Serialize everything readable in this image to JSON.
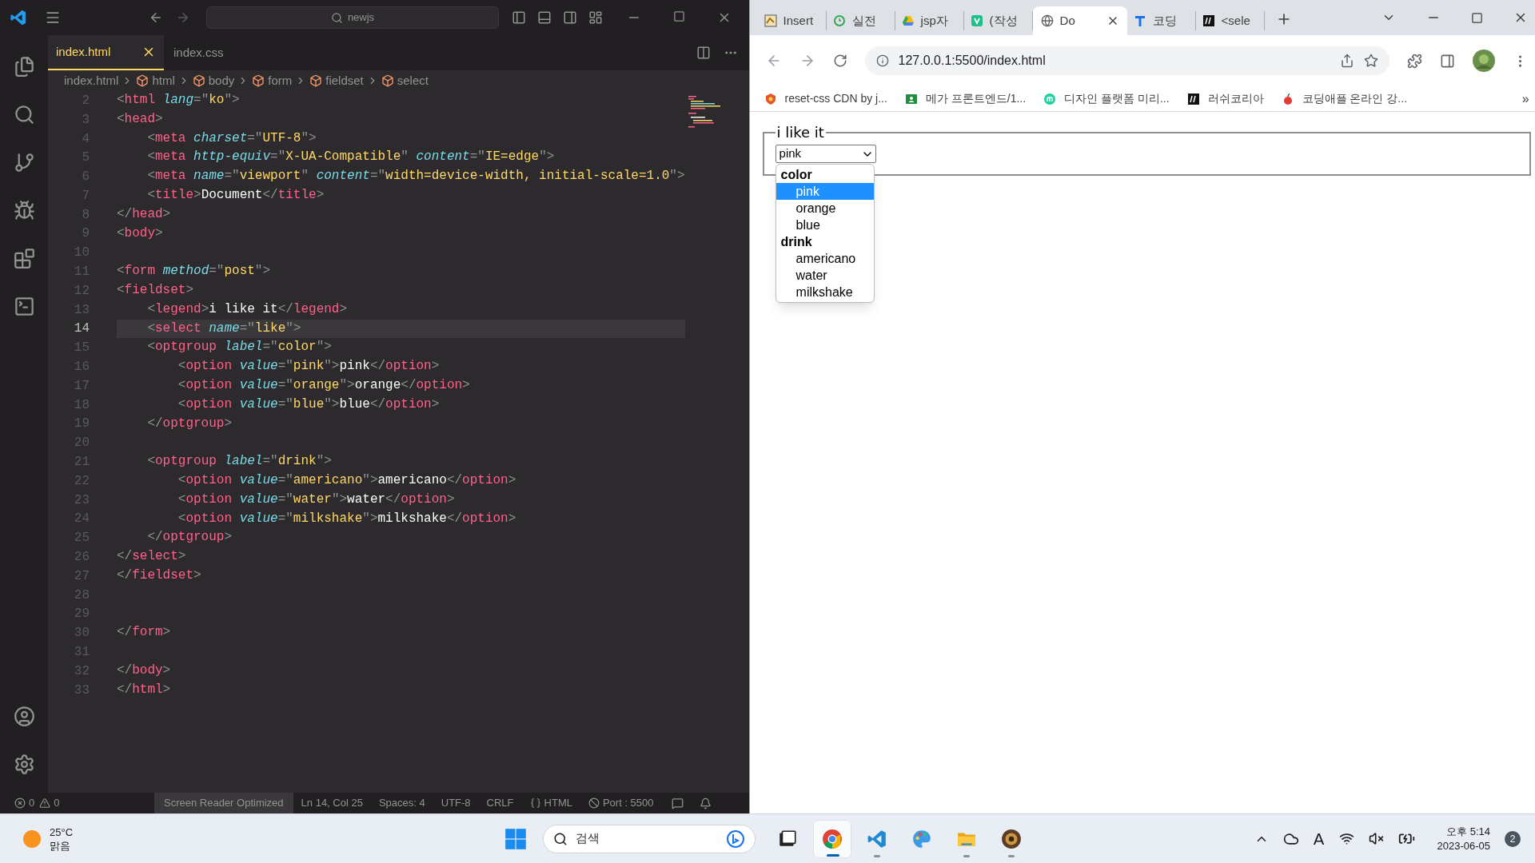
{
  "vscode": {
    "title_bar": {
      "search": "newjs"
    },
    "tabs": [
      {
        "label": "index.html",
        "selected": true
      },
      {
        "label": "index.css",
        "selected": false
      }
    ],
    "breadcrumb": [
      {
        "kind": "file",
        "label": "index.html"
      },
      {
        "kind": "element",
        "label": "html"
      },
      {
        "kind": "element",
        "label": "body"
      },
      {
        "kind": "element",
        "label": "form"
      },
      {
        "kind": "element",
        "label": "fieldset"
      },
      {
        "kind": "element",
        "label": "select"
      }
    ],
    "lines": [
      {
        "number": "2",
        "current": false,
        "tokens": [
          {
            "kind": "punct",
            "text": "<"
          },
          {
            "kind": "tag",
            "text": "html "
          },
          {
            "kind": "attr",
            "text": "lang"
          },
          {
            "kind": "punct",
            "text": "=\""
          },
          {
            "kind": "string",
            "text": "ko"
          },
          {
            "kind": "punct",
            "text": "\">"
          }
        ]
      },
      {
        "number": "3",
        "current": false,
        "tokens": [
          {
            "kind": "punct",
            "text": "<"
          },
          {
            "kind": "tag",
            "text": "head"
          },
          {
            "kind": "punct",
            "text": ">"
          }
        ]
      },
      {
        "number": "4",
        "current": false,
        "tokens": [
          {
            "kind": "punct",
            "text": "    <"
          },
          {
            "kind": "tag",
            "text": "meta "
          },
          {
            "kind": "attr",
            "text": "charset"
          },
          {
            "kind": "punct",
            "text": "=\""
          },
          {
            "kind": "string",
            "text": "UTF-8"
          },
          {
            "kind": "punct",
            "text": "\">"
          }
        ]
      },
      {
        "number": "5",
        "current": false,
        "tokens": [
          {
            "kind": "punct",
            "text": "    <"
          },
          {
            "kind": "tag",
            "text": "meta "
          },
          {
            "kind": "attr",
            "text": "http-equiv"
          },
          {
            "kind": "punct",
            "text": "=\""
          },
          {
            "kind": "string",
            "text": "X-UA-Compatible"
          },
          {
            "kind": "punct",
            "text": "\" "
          },
          {
            "kind": "attr",
            "text": "content"
          },
          {
            "kind": "punct",
            "text": "=\""
          },
          {
            "kind": "string",
            "text": "IE=edge"
          },
          {
            "kind": "punct",
            "text": "\">"
          }
        ]
      },
      {
        "number": "6",
        "current": false,
        "tokens": [
          {
            "kind": "punct",
            "text": "    <"
          },
          {
            "kind": "tag",
            "text": "meta "
          },
          {
            "kind": "attr",
            "text": "name"
          },
          {
            "kind": "punct",
            "text": "=\""
          },
          {
            "kind": "string",
            "text": "viewport"
          },
          {
            "kind": "punct",
            "text": "\" "
          },
          {
            "kind": "attr",
            "text": "content"
          },
          {
            "kind": "punct",
            "text": "=\""
          },
          {
            "kind": "string",
            "text": "width=device-width, initial-scale=1.0"
          },
          {
            "kind": "punct",
            "text": "\">"
          }
        ]
      },
      {
        "number": "7",
        "current": false,
        "tokens": [
          {
            "kind": "punct",
            "text": "    <"
          },
          {
            "kind": "tag",
            "text": "title"
          },
          {
            "kind": "punct",
            "text": ">"
          },
          {
            "kind": "text",
            "text": "Document"
          },
          {
            "kind": "punct",
            "text": "</"
          },
          {
            "kind": "tag",
            "text": "title"
          },
          {
            "kind": "punct",
            "text": ">"
          }
        ]
      },
      {
        "number": "8",
        "current": false,
        "tokens": [
          {
            "kind": "punct",
            "text": "</"
          },
          {
            "kind": "tag",
            "text": "head"
          },
          {
            "kind": "punct",
            "text": ">"
          }
        ]
      },
      {
        "number": "9",
        "current": false,
        "tokens": [
          {
            "kind": "punct",
            "text": "<"
          },
          {
            "kind": "tag",
            "text": "body"
          },
          {
            "kind": "punct",
            "text": ">"
          }
        ]
      },
      {
        "number": "10",
        "current": false
      },
      {
        "number": "11",
        "current": false,
        "tokens": [
          {
            "kind": "punct",
            "text": "<"
          },
          {
            "kind": "tag",
            "text": "form "
          },
          {
            "kind": "attr",
            "text": "method"
          },
          {
            "kind": "punct",
            "text": "=\""
          },
          {
            "kind": "string",
            "text": "post"
          },
          {
            "kind": "punct",
            "text": "\">"
          }
        ]
      },
      {
        "number": "12",
        "current": false,
        "tokens": [
          {
            "kind": "punct",
            "text": "<"
          },
          {
            "kind": "tag",
            "text": "fieldset"
          },
          {
            "kind": "punct",
            "text": ">"
          }
        ]
      },
      {
        "number": "13",
        "current": false,
        "tokens": [
          {
            "kind": "punct",
            "text": "    <"
          },
          {
            "kind": "tag",
            "text": "legend"
          },
          {
            "kind": "punct",
            "text": ">"
          },
          {
            "kind": "text",
            "text": "i like it"
          },
          {
            "kind": "punct",
            "text": "</"
          },
          {
            "kind": "tag",
            "text": "legend"
          },
          {
            "kind": "punct",
            "text": ">"
          }
        ]
      },
      {
        "number": "14",
        "current": true,
        "tokens": [
          {
            "kind": "punct",
            "text": "    <"
          },
          {
            "kind": "tag",
            "text": "select "
          },
          {
            "kind": "attr",
            "text": "name"
          },
          {
            "kind": "punct",
            "text": "=\""
          },
          {
            "kind": "string",
            "text": "like"
          },
          {
            "kind": "punct",
            "text": "\">"
          }
        ]
      },
      {
        "number": "15",
        "current": false,
        "tokens": [
          {
            "kind": "punct",
            "text": "    <"
          },
          {
            "kind": "tag",
            "text": "optgroup "
          },
          {
            "kind": "attr",
            "text": "label"
          },
          {
            "kind": "punct",
            "text": "=\""
          },
          {
            "kind": "string",
            "text": "color"
          },
          {
            "kind": "punct",
            "text": "\">"
          }
        ]
      },
      {
        "number": "16",
        "current": false,
        "tokens": [
          {
            "kind": "punct",
            "text": "        <"
          },
          {
            "kind": "tag",
            "text": "option "
          },
          {
            "kind": "attr",
            "text": "value"
          },
          {
            "kind": "punct",
            "text": "=\""
          },
          {
            "kind": "string",
            "text": "pink"
          },
          {
            "kind": "punct",
            "text": "\">"
          },
          {
            "kind": "text",
            "text": "pink"
          },
          {
            "kind": "punct",
            "text": "</"
          },
          {
            "kind": "tag",
            "text": "option"
          },
          {
            "kind": "punct",
            "text": ">"
          }
        ]
      },
      {
        "number": "17",
        "current": false,
        "tokens": [
          {
            "kind": "punct",
            "text": "        <"
          },
          {
            "kind": "tag",
            "text": "option "
          },
          {
            "kind": "attr",
            "text": "value"
          },
          {
            "kind": "punct",
            "text": "=\""
          },
          {
            "kind": "string",
            "text": "orange"
          },
          {
            "kind": "punct",
            "text": "\">"
          },
          {
            "kind": "text",
            "text": "orange"
          },
          {
            "kind": "punct",
            "text": "</"
          },
          {
            "kind": "tag",
            "text": "option"
          },
          {
            "kind": "punct",
            "text": ">"
          }
        ]
      },
      {
        "number": "18",
        "current": false,
        "tokens": [
          {
            "kind": "punct",
            "text": "        <"
          },
          {
            "kind": "tag",
            "text": "option "
          },
          {
            "kind": "attr",
            "text": "value"
          },
          {
            "kind": "punct",
            "text": "=\""
          },
          {
            "kind": "string",
            "text": "blue"
          },
          {
            "kind": "punct",
            "text": "\">"
          },
          {
            "kind": "text",
            "text": "blue"
          },
          {
            "kind": "punct",
            "text": "</"
          },
          {
            "kind": "tag",
            "text": "option"
          },
          {
            "kind": "punct",
            "text": ">"
          }
        ]
      },
      {
        "number": "19",
        "current": false,
        "tokens": [
          {
            "kind": "punct",
            "text": "    </"
          },
          {
            "kind": "tag",
            "text": "optgroup"
          },
          {
            "kind": "punct",
            "text": ">"
          }
        ]
      },
      {
        "number": "20",
        "current": false
      },
      {
        "number": "21",
        "current": false,
        "tokens": [
          {
            "kind": "punct",
            "text": "    <"
          },
          {
            "kind": "tag",
            "text": "optgroup "
          },
          {
            "kind": "attr",
            "text": "label"
          },
          {
            "kind": "punct",
            "text": "=\""
          },
          {
            "kind": "string",
            "text": "drink"
          },
          {
            "kind": "punct",
            "text": "\">"
          }
        ]
      },
      {
        "number": "22",
        "current": false,
        "tokens": [
          {
            "kind": "punct",
            "text": "        <"
          },
          {
            "kind": "tag",
            "text": "option "
          },
          {
            "kind": "attr",
            "text": "value"
          },
          {
            "kind": "punct",
            "text": "=\""
          },
          {
            "kind": "string",
            "text": "americano"
          },
          {
            "kind": "punct",
            "text": "\">"
          },
          {
            "kind": "text",
            "text": "americano"
          },
          {
            "kind": "punct",
            "text": "</"
          },
          {
            "kind": "tag",
            "text": "option"
          },
          {
            "kind": "punct",
            "text": ">"
          }
        ]
      },
      {
        "number": "23",
        "current": false,
        "tokens": [
          {
            "kind": "punct",
            "text": "        <"
          },
          {
            "kind": "tag",
            "text": "option "
          },
          {
            "kind": "attr",
            "text": "value"
          },
          {
            "kind": "punct",
            "text": "=\""
          },
          {
            "kind": "string",
            "text": "water"
          },
          {
            "kind": "punct",
            "text": "\">"
          },
          {
            "kind": "text",
            "text": "water"
          },
          {
            "kind": "punct",
            "text": "</"
          },
          {
            "kind": "tag",
            "text": "option"
          },
          {
            "kind": "punct",
            "text": ">"
          }
        ]
      },
      {
        "number": "24",
        "current": false,
        "tokens": [
          {
            "kind": "punct",
            "text": "        <"
          },
          {
            "kind": "tag",
            "text": "option "
          },
          {
            "kind": "attr",
            "text": "value"
          },
          {
            "kind": "punct",
            "text": "=\""
          },
          {
            "kind": "string",
            "text": "milkshake"
          },
          {
            "kind": "punct",
            "text": "\">"
          },
          {
            "kind": "text",
            "text": "milkshake"
          },
          {
            "kind": "punct",
            "text": "</"
          },
          {
            "kind": "tag",
            "text": "option"
          },
          {
            "kind": "punct",
            "text": ">"
          }
        ]
      },
      {
        "number": "25",
        "current": false,
        "tokens": [
          {
            "kind": "punct",
            "text": "    </"
          },
          {
            "kind": "tag",
            "text": "optgroup"
          },
          {
            "kind": "punct",
            "text": ">"
          }
        ]
      },
      {
        "number": "26",
        "current": false,
        "tokens": [
          {
            "kind": "punct",
            "text": "</"
          },
          {
            "kind": "tag",
            "text": "select"
          },
          {
            "kind": "punct",
            "text": ">"
          }
        ]
      },
      {
        "number": "27",
        "current": false,
        "tokens": [
          {
            "kind": "punct",
            "text": "</"
          },
          {
            "kind": "tag",
            "text": "fieldset"
          },
          {
            "kind": "punct",
            "text": ">"
          }
        ]
      },
      {
        "number": "28",
        "current": false
      },
      {
        "number": "29",
        "current": false
      },
      {
        "number": "30",
        "current": false,
        "tokens": [
          {
            "kind": "punct",
            "text": "</"
          },
          {
            "kind": "tag",
            "text": "form"
          },
          {
            "kind": "punct",
            "text": ">"
          }
        ]
      },
      {
        "number": "31",
        "current": false
      },
      {
        "number": "32",
        "current": false,
        "tokens": [
          {
            "kind": "punct",
            "text": "</"
          },
          {
            "kind": "tag",
            "text": "body"
          },
          {
            "kind": "punct",
            "text": ">"
          }
        ]
      },
      {
        "number": "33",
        "current": false,
        "tokens": [
          {
            "kind": "punct",
            "text": "</"
          },
          {
            "kind": "tag",
            "text": "html"
          },
          {
            "kind": "punct",
            "text": ">"
          }
        ]
      }
    ],
    "status_bar": {
      "errors": "0",
      "warnings": "0",
      "items": [
        {
          "kind": "mode",
          "text": "Screen Reader Optimized"
        },
        {
          "kind": "plain",
          "text": "Ln 14, Col 25"
        },
        {
          "kind": "plain",
          "text": "Spaces: 4"
        },
        {
          "kind": "plain",
          "text": "UTF-8"
        },
        {
          "kind": "plain",
          "text": "CRLF"
        },
        {
          "kind": "language",
          "text": "HTML"
        },
        {
          "kind": "port",
          "text": "Port : 5500"
        }
      ]
    }
  },
  "browser": {
    "tabs": [
      {
        "kind": "tiger",
        "label": "Insert",
        "selected": false
      },
      {
        "kind": "clock",
        "label": "실전",
        "selected": false
      },
      {
        "kind": "drive",
        "label": "jsp자",
        "selected": false
      },
      {
        "kind": "green",
        "label": "(작성",
        "selected": false
      },
      {
        "kind": "globe",
        "label": "Do",
        "selected": true
      },
      {
        "kind": "blue",
        "label": "코딩",
        "selected": false
      },
      {
        "kind": "black",
        "label": "<sele",
        "selected": false
      }
    ],
    "url": "127.0.0.1:5500/index.html",
    "bookmarks": [
      {
        "kind": "shield",
        "label": "reset-css CDN by j..."
      },
      {
        "kind": "board",
        "label": "메가 프론트엔드/1..."
      },
      {
        "kind": "circle",
        "label": "디자인 플랫폼 미리..."
      },
      {
        "kind": "black",
        "label": "러쉬코리아"
      },
      {
        "kind": "apple",
        "label": "코딩애플 온라인 강..."
      }
    ],
    "bookmarks_overflow": "»",
    "page": {
      "legend": "i like it",
      "select": {
        "value": "pink"
      },
      "dropdown": [
        {
          "label": "color",
          "options": [
            {
              "label": "pink",
              "selected": true
            },
            {
              "label": "orange",
              "selected": false
            },
            {
              "label": "blue",
              "selected": false
            }
          ]
        },
        {
          "label": "drink",
          "options": [
            {
              "label": "americano",
              "selected": false
            },
            {
              "label": "water",
              "selected": false
            },
            {
              "label": "milkshake",
              "selected": false
            }
          ]
        }
      ]
    }
  },
  "taskbar": {
    "weather": {
      "temperature": "25°C",
      "condition": "맑음"
    },
    "search": {
      "placeholder": "검색"
    },
    "apps": [
      {
        "kind": "taskview",
        "open": false,
        "selected": false
      },
      {
        "kind": "browser",
        "open": true,
        "selected": true
      },
      {
        "kind": "editor",
        "open": true,
        "selected": false
      },
      {
        "kind": "palette",
        "open": false,
        "selected": false
      },
      {
        "kind": "folder",
        "open": true,
        "selected": false
      },
      {
        "kind": "game",
        "open": true,
        "selected": false
      }
    ],
    "input_indicator": "A",
    "time": "오후 5:14",
    "date": "2023-06-05",
    "notifications": "2"
  }
}
